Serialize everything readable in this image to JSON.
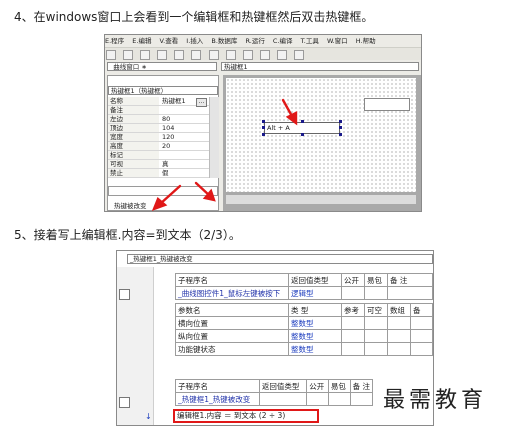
{
  "step4": {
    "text": "4、在windows窗口上会看到一个编辑框和热键框然后双击热键框。"
  },
  "step5": {
    "text": "5、接着写上编辑框.内容=到文本（2/3）。"
  },
  "ide1": {
    "menu": [
      "E.程序",
      "E.编辑",
      "V.查看",
      "I.插入",
      "B.数据库",
      "R.运行",
      "C.编译",
      "T.工具",
      "W.窗口",
      "H.帮助"
    ],
    "left_combo": "_曲线窗口 ∗",
    "right_combo": "热键框1",
    "prop_title_combo": "热键框1（热键框）",
    "properties": [
      {
        "key": "名称",
        "value": "热键框1"
      },
      {
        "key": "备注",
        "value": ""
      },
      {
        "key": "左边",
        "value": "80"
      },
      {
        "key": "顶边",
        "value": "104"
      },
      {
        "key": "宽度",
        "value": "120"
      },
      {
        "key": "高度",
        "value": "20"
      },
      {
        "key": "标记",
        "value": ""
      },
      {
        "key": "可视",
        "value": "真"
      },
      {
        "key": "禁止",
        "value": "假"
      }
    ],
    "status_text": "热键被改变",
    "hotkey_text": "Alt + A"
  },
  "ide2": {
    "combo_text": "_热键框1_热键被改变",
    "table1": {
      "header": [
        "子程序名",
        "返回值类型",
        "公开",
        "易包",
        "备 注"
      ],
      "row1": [
        "_曲线图控件1_鼠标左键被按下",
        "逻辑型"
      ],
      "param_header": [
        "参数名",
        "类 型",
        "参考",
        "可空",
        "数组",
        "备"
      ],
      "params": [
        {
          "name": "横向位置",
          "type": "整数型"
        },
        {
          "name": "纵向位置",
          "type": "整数型"
        },
        {
          "name": "功能键状态",
          "type": "整数型"
        }
      ]
    },
    "table2": {
      "header": [
        "子程序名",
        "返回值类型",
        "公开",
        "易包",
        "备 注"
      ],
      "row1": "_热键框1_热键被改变"
    },
    "code_line": "编辑框1.内容 ＝ 到文本 (2 ÷ 3)"
  },
  "watermark": "最需教育"
}
